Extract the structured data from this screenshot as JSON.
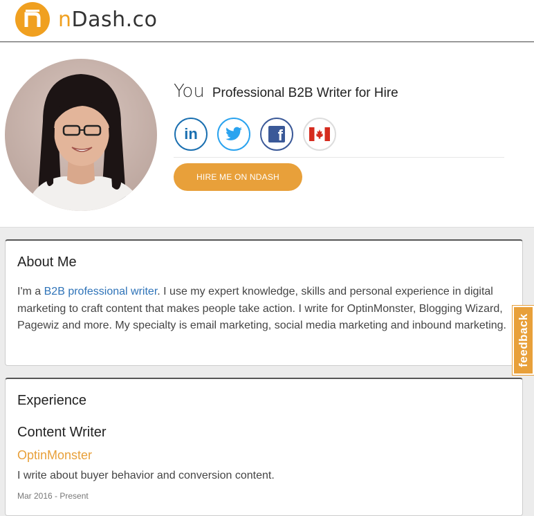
{
  "header": {
    "logo_mark": "n",
    "logo_brand_n": "n",
    "logo_brand_rest": "Dash.co",
    "logo_color": "#f0a020"
  },
  "profile": {
    "name": "You",
    "tagline": "Professional B2B Writer for Hire",
    "socials": [
      {
        "icon": "linkedin-icon",
        "label": "in",
        "color": "#1a6fb0"
      },
      {
        "icon": "twitter-icon",
        "color": "#2aa3ef"
      },
      {
        "icon": "facebook-icon",
        "label": "f",
        "color": "#3b5998"
      },
      {
        "icon": "canada-flag-icon",
        "color": "#d52b1e"
      }
    ],
    "hire_button": "HIRE ME ON NDASH",
    "accent_color": "#e8a03a"
  },
  "about": {
    "title": "About Me",
    "text_before": "I'm a ",
    "link_text": "B2B professional writer",
    "text_after": ". I use my expert knowledge, skills and personal experience in digital marketing to craft content that makes people take action. I write for OptinMonster, Blogging Wizard, Pagewiz and more. My specialty is email marketing, social media marketing and inbound marketing."
  },
  "experience": {
    "title": "Experience",
    "jobs": [
      {
        "title": "Content Writer",
        "company": "OptinMonster",
        "description": "I write about buyer behavior and conversion content.",
        "dates": "Mar 2016 - Present"
      }
    ]
  },
  "feedback": {
    "label": "feedback"
  }
}
